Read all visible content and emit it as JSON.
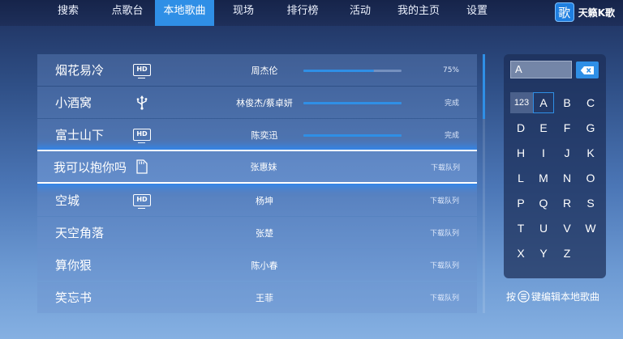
{
  "nav": {
    "tabs": [
      {
        "label": "搜索"
      },
      {
        "label": "点歌台"
      },
      {
        "label": "本地歌曲",
        "active": true
      },
      {
        "label": "现场"
      },
      {
        "label": "排行榜"
      },
      {
        "label": "活动"
      },
      {
        "label": "我的主页"
      },
      {
        "label": "设置"
      }
    ],
    "brand_logo_char": "歌",
    "brand_name": "天籁K歌"
  },
  "songs": [
    {
      "title": "烟花易冷",
      "badge": "hd-icon",
      "artist": "周杰伦",
      "progress": 0.72,
      "status": "75%"
    },
    {
      "title": "小酒窝",
      "badge": "usb-icon",
      "artist": "林俊杰/蔡卓妍",
      "progress": 1.0,
      "status": "完成"
    },
    {
      "title": "富士山下",
      "badge": "hd-icon",
      "artist": "陈奕迅",
      "progress": 1.0,
      "status": "完成"
    },
    {
      "title": "我可以抱你吗",
      "badge": "sd-card-icon",
      "artist": "张惠妹",
      "status": "下载队列",
      "selected": true
    },
    {
      "title": "空城",
      "badge": "hd-icon",
      "artist": "杨坤",
      "status": "下载队列"
    },
    {
      "title": "天空角落",
      "badge": "",
      "artist": "张楚",
      "status": "下载队列"
    },
    {
      "title": "算你狠",
      "badge": "",
      "artist": "陈小春",
      "status": "下载队列"
    },
    {
      "title": "笑忘书",
      "badge": "",
      "artist": "王菲",
      "status": "下载队列"
    }
  ],
  "keyboard": {
    "input_value": "A",
    "backspace_icon": "backspace-icon",
    "selected_key": "A",
    "rows": [
      [
        "123",
        "A",
        "B",
        "C"
      ],
      [
        "D",
        "E",
        "F",
        "G"
      ],
      [
        "H",
        "I",
        "J",
        "K"
      ],
      [
        "L",
        "M",
        "N",
        "O"
      ],
      [
        "P",
        "Q",
        "R",
        "S"
      ],
      [
        "T",
        "U",
        "V",
        "W"
      ],
      [
        "X",
        "Y",
        "Z"
      ]
    ],
    "hint_prefix": "按",
    "hint_icon": "menu-icon",
    "hint_suffix": "键编辑本地歌曲"
  },
  "colors": {
    "accent": "#2f8fe6",
    "glow": "#288cff"
  }
}
